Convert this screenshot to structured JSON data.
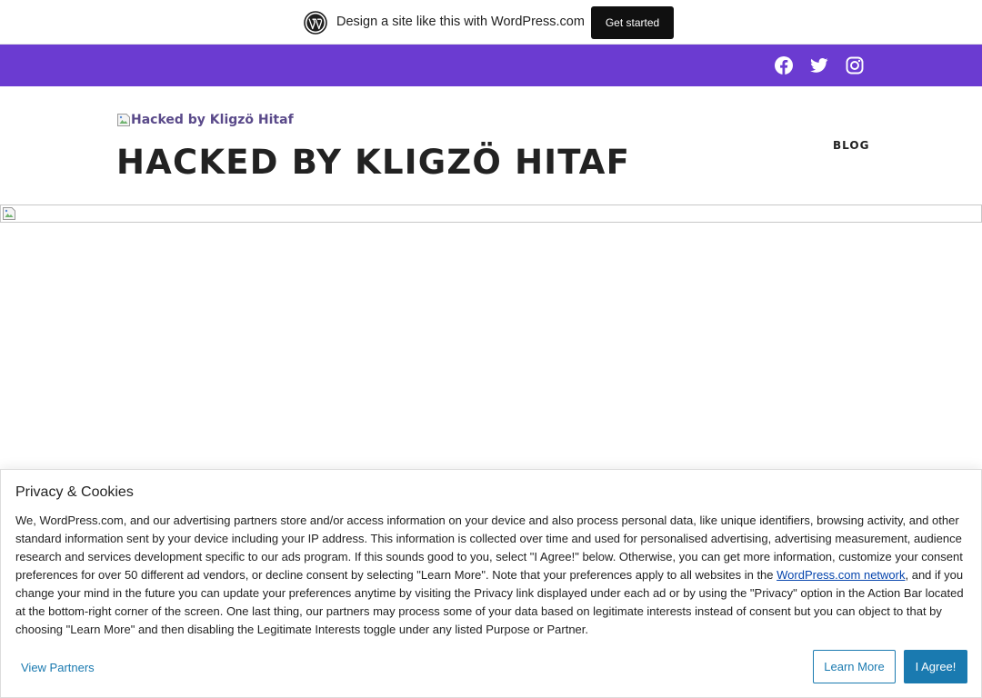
{
  "promo": {
    "text": "Design a site like this with WordPress.com",
    "button": "Get started",
    "logo_icon": "wordpress-logo-icon"
  },
  "social": {
    "color": "#6b3bd1",
    "icons": [
      "facebook-icon",
      "twitter-icon",
      "instagram-icon"
    ]
  },
  "header": {
    "logo_alt": "Hacked by Kligzö Hitaf",
    "site_title": "HACKED BY KLIGZÖ HITAF",
    "nav": [
      "BLOG"
    ]
  },
  "cookie": {
    "title": "Privacy & Cookies",
    "text_before_link": "We, WordPress.com, and our advertising partners store and/or access information on your device and also process personal data, like unique identifiers, browsing activity, and other standard information sent by your device including your IP address. This information is collected over time and used for personalised advertising, advertising measurement, audience research and services development specific to our ads program. If this sounds good to you, select \"I Agree!\" below. Otherwise, you can get more information, customize your consent preferences for over 50 different ad vendors, or decline consent by selecting \"Learn More\". Note that your preferences apply to all websites in the ",
    "link_text": "WordPress.com network",
    "text_after_link": ", and if you change your mind in the future you can update your preferences anytime by visiting the Privacy link displayed under each ad or by using the \"Privacy\" option in the Action Bar located at the bottom-right corner of the screen. One last thing, our partners may process some of your data based on legitimate interests instead of consent but you can object to that by choosing \"Learn More\" and then disabling the Legitimate Interests toggle under any listed Purpose or Partner.",
    "view_partners": "View Partners",
    "learn_more": "Learn More",
    "agree": "I Agree!",
    "accent_color": "#1a7ab0"
  }
}
